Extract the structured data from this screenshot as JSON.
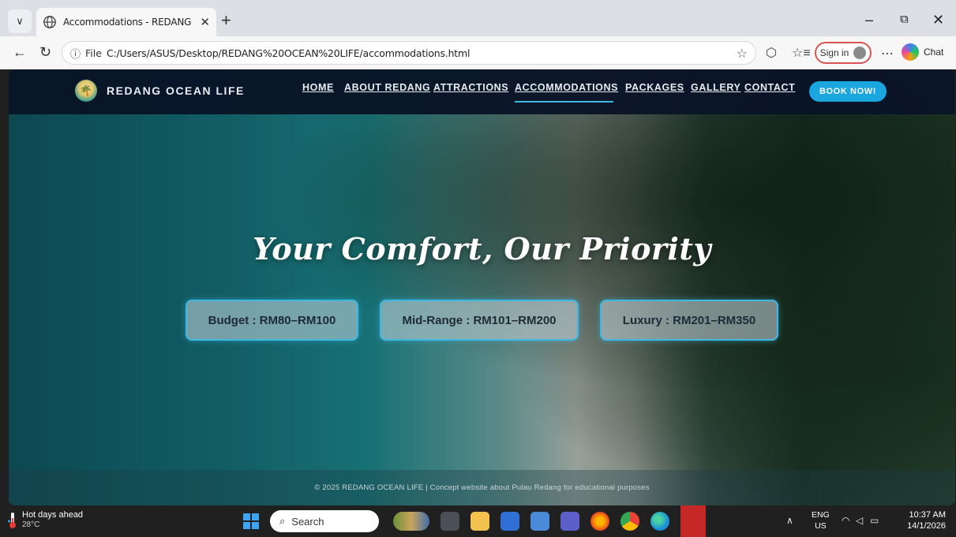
{
  "browser": {
    "tab_title": "Accommodations - REDANG OCEAN LIFE",
    "tab_title_display": "Accommodations - REDANG OCE",
    "url_scheme_label": "File",
    "url_path": "C:/Users/ASUS/Desktop/REDANG%20OCEAN%20LIFE/accommodations.html",
    "sign_in_label": "Sign in",
    "chat_label": "Chat"
  },
  "site": {
    "brand": "REDANG OCEAN LIFE",
    "nav": [
      {
        "label": "HOME",
        "active": false
      },
      {
        "label": "ABOUT REDANG",
        "active": false
      },
      {
        "label": "ATTRACTIONS",
        "active": false
      },
      {
        "label": "ACCOMMODATIONS",
        "active": true
      },
      {
        "label": "PACKAGES",
        "active": false
      },
      {
        "label": "GALLERY",
        "active": false
      },
      {
        "label": "CONTACT",
        "active": false
      }
    ],
    "cta": "BOOK NOW!",
    "hero_title": "Your Comfort, Our Priority",
    "price_tiers": [
      {
        "label": "Budget : RM80–RM100"
      },
      {
        "label": "Mid-Range : RM101–RM200"
      },
      {
        "label": "Luxury : RM201–RM350"
      }
    ],
    "footer": "© 2025 REDANG OCEAN LIFE | Concept website about Pulau Redang for educational purposes",
    "accent_color": "#3fb9e3",
    "nav_bg_color": "#09142a"
  },
  "taskbar": {
    "weather_title": "Hot days ahead",
    "weather_temp": "28°C",
    "search_label": "Search",
    "lang_line1": "ENG",
    "lang_line2": "US",
    "time": "10:37 AM",
    "date": "14/1/2026"
  }
}
